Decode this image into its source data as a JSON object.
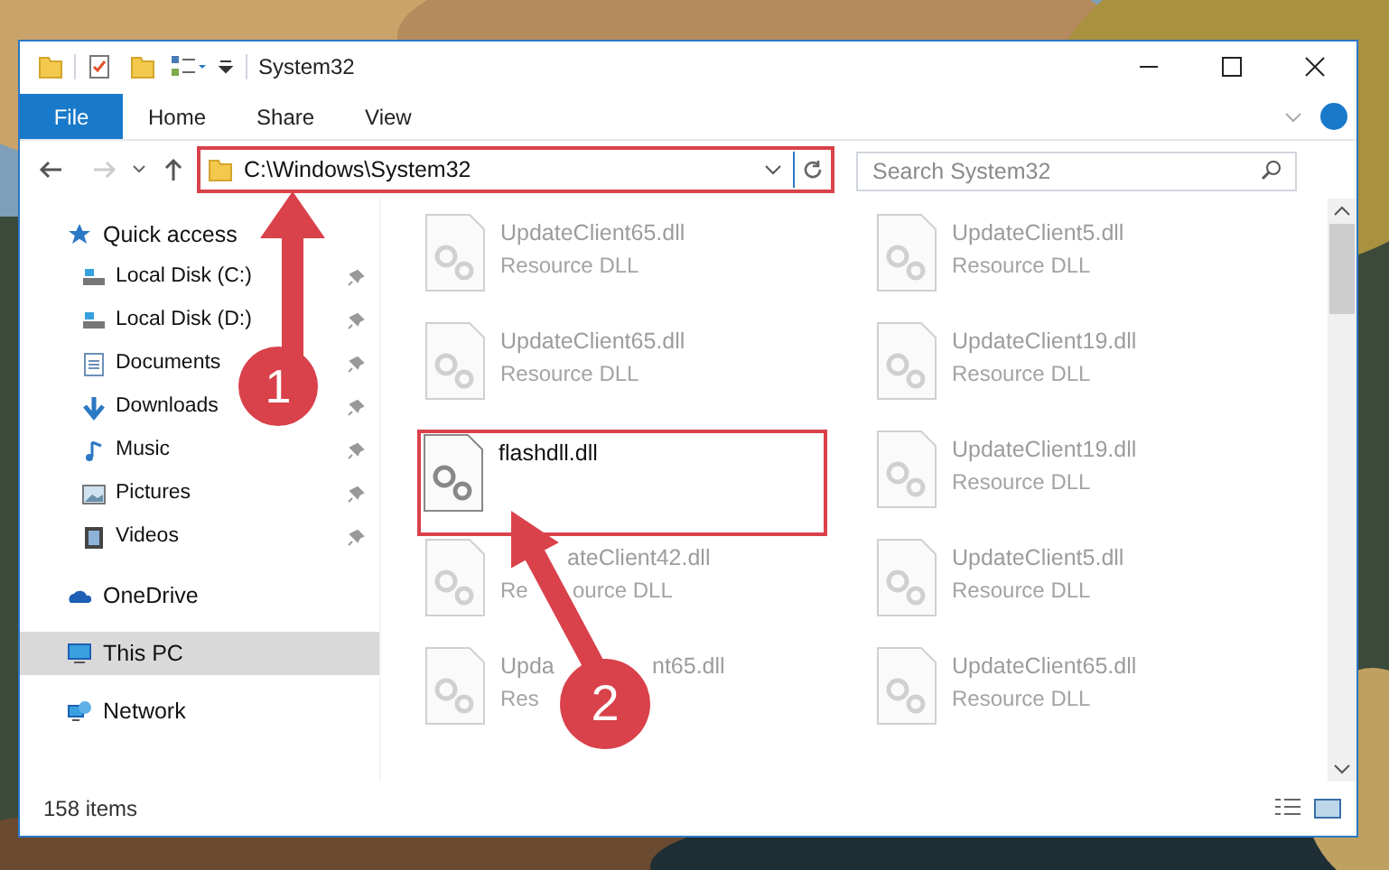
{
  "window": {
    "title": "System32"
  },
  "ribbon": {
    "tabs": [
      {
        "label": "File",
        "selected": true
      },
      {
        "label": "Home",
        "selected": false
      },
      {
        "label": "Share",
        "selected": false
      },
      {
        "label": "View",
        "selected": false
      }
    ]
  },
  "address": {
    "value": "C:\\Windows\\System32"
  },
  "search": {
    "placeholder": "Search System32"
  },
  "sidebar": {
    "items": [
      {
        "label": "Quick access",
        "kind": "star",
        "selected": false,
        "children": [
          {
            "label": "Local Disk (C:)",
            "kind": "drive",
            "pinned": true
          },
          {
            "label": "Local Disk (D:)",
            "kind": "drive",
            "pinned": true
          },
          {
            "label": "Documents",
            "kind": "document",
            "pinned": true
          },
          {
            "label": "Downloads",
            "kind": "download",
            "pinned": true
          },
          {
            "label": "Music",
            "kind": "music",
            "pinned": true
          },
          {
            "label": "Pictures",
            "kind": "pictures",
            "pinned": true
          },
          {
            "label": "Videos",
            "kind": "videos",
            "pinned": true
          }
        ]
      },
      {
        "label": "OneDrive",
        "kind": "cloud",
        "selected": false
      },
      {
        "label": "This PC",
        "kind": "pc",
        "selected": true
      },
      {
        "label": "Network",
        "kind": "network",
        "selected": false
      }
    ]
  },
  "files": [
    {
      "name": "UpdateClient65.dll",
      "type": "Resource DLL",
      "blurred": true,
      "highlighted": false
    },
    {
      "name": "UpdateClient5.dll",
      "type": "Resource DLL",
      "blurred": true,
      "highlighted": false
    },
    {
      "name": "UpdateClient65.dll",
      "type": "Resource DLL",
      "blurred": true,
      "highlighted": false
    },
    {
      "name": "UpdateClient19.dll",
      "type": "Resource DLL",
      "blurred": true,
      "highlighted": false
    },
    {
      "name": "flashdll.dll",
      "blurred": false,
      "highlighted": true
    },
    {
      "name": "UpdateClient19.dll",
      "type": "Resource DLL",
      "blurred": true,
      "highlighted": false
    },
    {
      "name_parts": [
        "ateClient42.dll"
      ],
      "type_parts": [
        "Re",
        "ource DLL"
      ],
      "blurred": true,
      "highlighted": false
    },
    {
      "name": "UpdateClient5.dll",
      "type": "Resource DLL",
      "blurred": true,
      "highlighted": false
    },
    {
      "name_parts": [
        "Upda",
        "nt65.dll"
      ],
      "type_parts": [
        "Res"
      ],
      "blurred": true,
      "highlighted": false
    },
    {
      "name": "UpdateClient65.dll",
      "type": "Resource DLL",
      "blurred": true,
      "highlighted": false
    }
  ],
  "status_bar": {
    "item_count": "158 items"
  },
  "annotations": [
    {
      "number": "1"
    },
    {
      "number": "2"
    }
  ]
}
